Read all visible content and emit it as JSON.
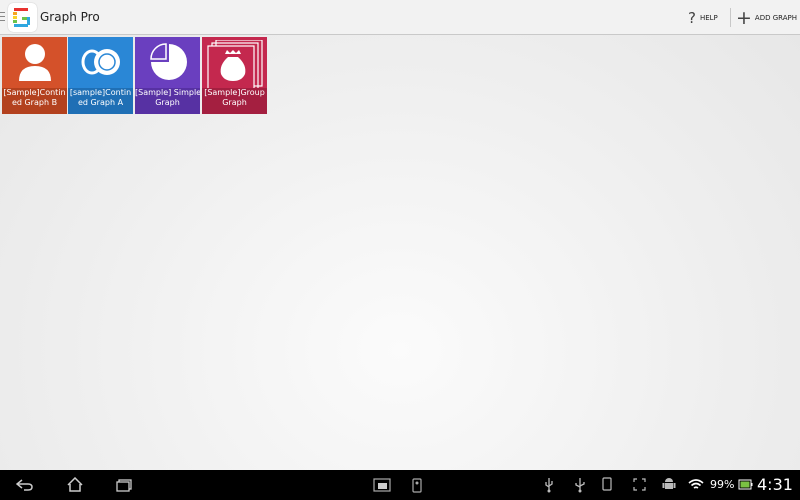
{
  "app": {
    "title": "Graph Pro"
  },
  "actionbar": {
    "help_label": "HELP",
    "add_label": "ADD GRAPH"
  },
  "tiles": [
    {
      "line1": "[Sample]Contin",
      "line2": "ed Graph B",
      "color": "#d4512a",
      "caption_color": "#b3411e",
      "icon": "person-icon"
    },
    {
      "line1": "[sample]Contin",
      "line2": "ed Graph A",
      "color": "#2a87d6",
      "caption_color": "#1f6fb5",
      "icon": "coins-icon"
    },
    {
      "line1": "[Sample] Simple",
      "line2": "Graph",
      "color": "#6a3fbf",
      "caption_color": "#5731a3",
      "icon": "pie-chart-icon"
    },
    {
      "line1": "[Sample]Group",
      "line2": "Graph",
      "color": "#c4284e",
      "caption_color": "#a41f40",
      "icon": "money-bag-icon"
    }
  ],
  "status": {
    "battery": "99%",
    "time": "4:31"
  },
  "colors": {
    "navbar": "#000000",
    "actionbar": "#f2f2f2",
    "battery_green": "#7ac143"
  }
}
